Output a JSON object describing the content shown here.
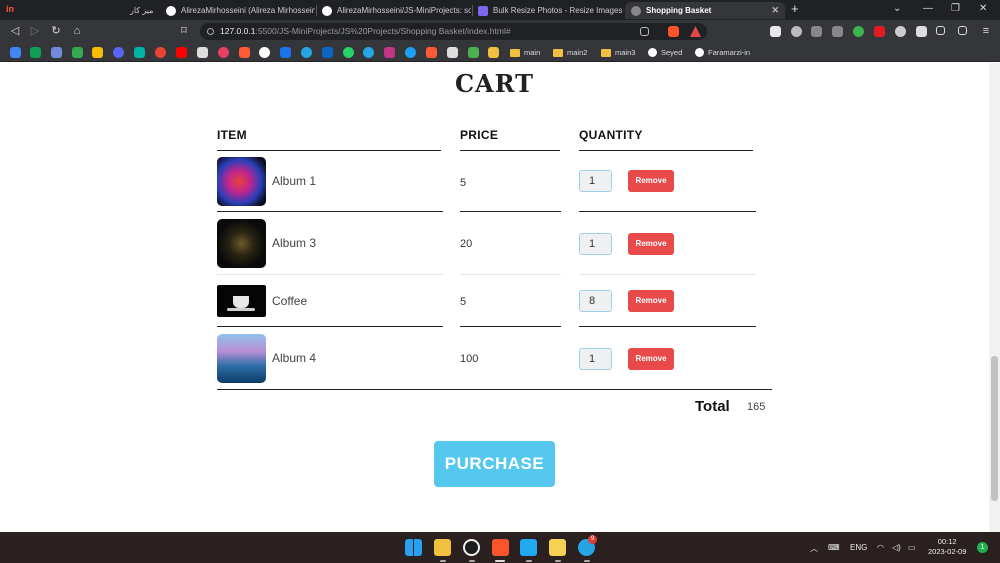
{
  "browser": {
    "tabs": [
      {
        "label": "میز کار",
        "active": false
      },
      {
        "label": "AlirezaMirhosseini (Alireza Mirhossein",
        "active": false
      },
      {
        "label": "AlirezaMirhosseini/JS-MiniProjects: so",
        "active": false
      },
      {
        "label": "Bulk Resize Photos - Resize Images",
        "active": false
      },
      {
        "label": "Shopping Basket",
        "active": true
      }
    ],
    "url_host": "127.0.0.1",
    "url_rest": ":5500/JS-MiniProjects/JS%20Projects/Shopping Basket/index.html#",
    "bookmarks": [
      "main",
      "main2",
      "main3",
      "Seyed",
      "Faramarzi-in"
    ]
  },
  "page": {
    "title": "CART",
    "headers": {
      "item": "ITEM",
      "price": "PRICE",
      "quantity": "QUANTITY"
    },
    "items": [
      {
        "name": "Album 1",
        "price": "5",
        "quantity": "1",
        "remove_label": "Remove"
      },
      {
        "name": "Album 3",
        "price": "20",
        "quantity": "1",
        "remove_label": "Remove"
      },
      {
        "name": "Coffee",
        "price": "5",
        "quantity": "8",
        "remove_label": "Remove"
      },
      {
        "name": "Album 4",
        "price": "100",
        "quantity": "1",
        "remove_label": "Remove"
      }
    ],
    "total_label": "Total",
    "total_value": "165",
    "purchase_label": "PURCHASE"
  },
  "taskbar": {
    "lang": "ENG",
    "time": "00:12",
    "date": "2023-02-09",
    "notifications": "1",
    "telegram_badge": "9"
  },
  "colors": {
    "remove_button": "#e84a4a",
    "purchase_button": "#56c8ef",
    "quantity_border": "#9fd0ea"
  }
}
